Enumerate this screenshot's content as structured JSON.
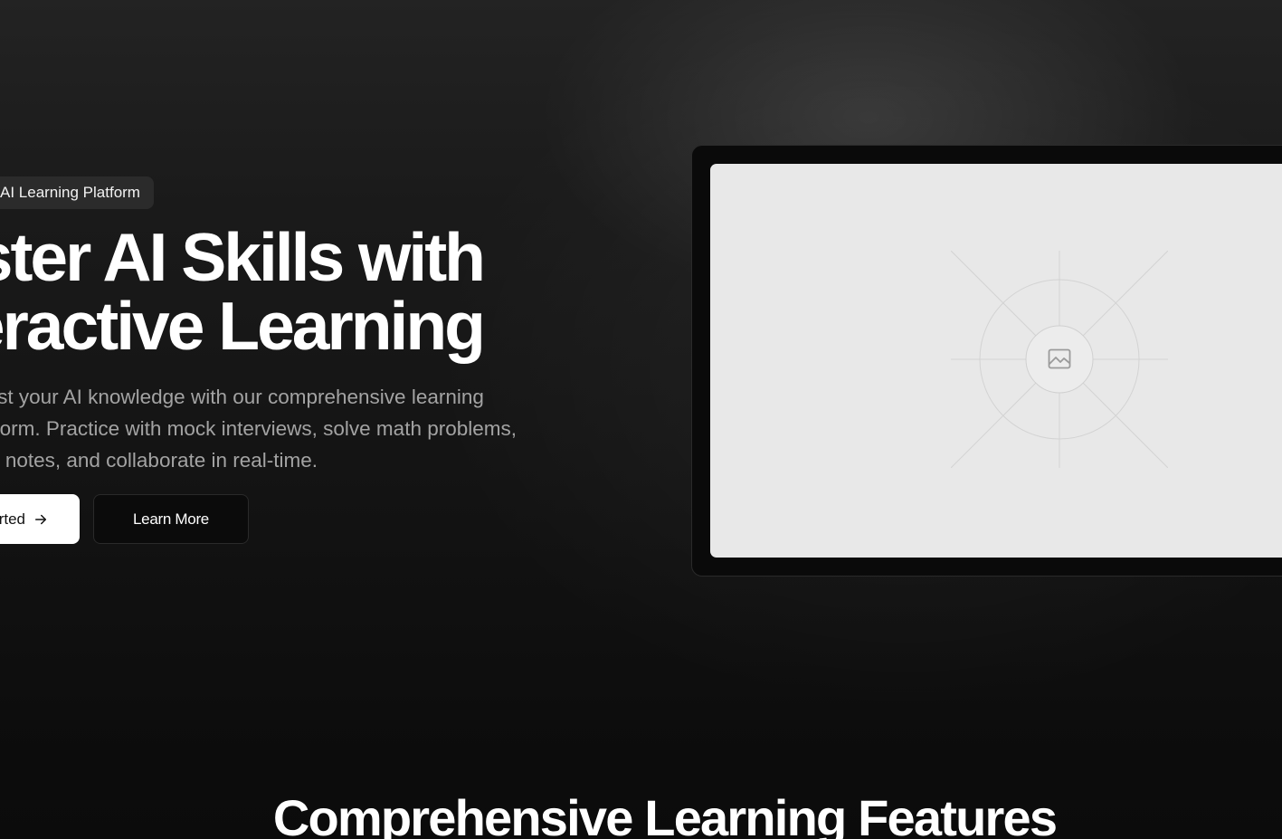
{
  "hero": {
    "badge": "AI Learning Platform",
    "headline_line1": "Master AI Skills with",
    "headline_line2": "Interactive Learning",
    "subtitle_line1": "Boost your AI knowledge with our comprehensive learning",
    "subtitle_line2": "platform. Practice with mock interviews, solve math problems,",
    "subtitle_line3": "take notes, and collaborate in real-time.",
    "primary_button": "Get Started",
    "secondary_button": "Learn More",
    "image_placeholder_icon": "image-icon"
  },
  "features": {
    "title": "Comprehensive Learning Features"
  }
}
